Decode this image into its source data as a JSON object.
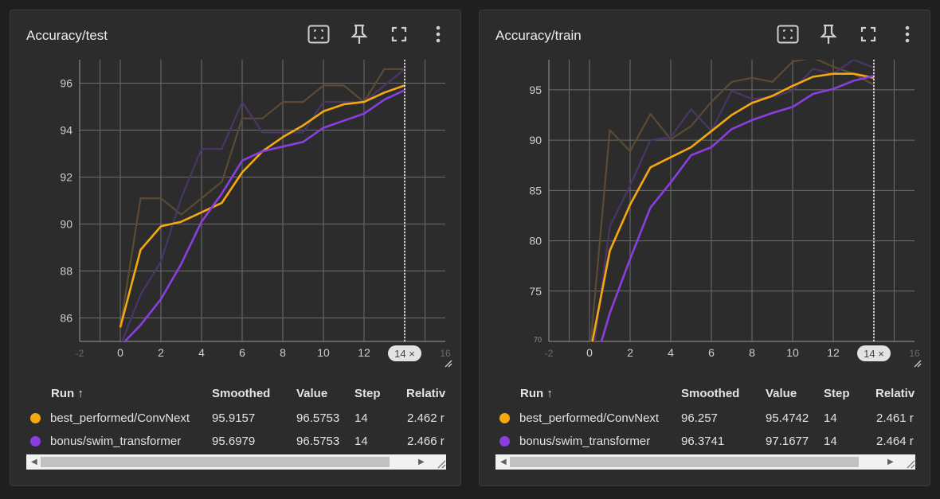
{
  "colors": {
    "convnext": "#f5a90e",
    "swim": "#8a3ee0",
    "convnext_raw": "#5b4b33",
    "swim_raw": "#4a3566",
    "grid": "#6e6e6e",
    "cursor": "#ffffff"
  },
  "icons": [
    "fit-domain-icon",
    "pin-icon",
    "fullscreen-icon",
    "more-vert-icon",
    "resize-corner-icon"
  ],
  "table": {
    "headers": {
      "run": "Run ↑",
      "smoothed": "Smoothed",
      "value": "Value",
      "step": "Step",
      "relative": "Relativ"
    }
  },
  "panels": [
    {
      "title": "Accuracy/test",
      "chart_data": {
        "type": "line",
        "x": [
          0,
          1,
          2,
          3,
          4,
          5,
          6,
          7,
          8,
          9,
          10,
          11,
          12,
          13,
          14
        ],
        "xlim": [
          -2,
          16
        ],
        "ylim": [
          85,
          97
        ],
        "y_ticks": [
          86,
          88,
          90,
          92,
          94,
          96
        ],
        "x_ticks": [
          0,
          2,
          4,
          6,
          8,
          10,
          12
        ],
        "x_tick_labels": [
          "-2",
          "0",
          "2",
          "4",
          "6",
          "8",
          "10",
          "12",
          "16"
        ],
        "cursor_step": 14,
        "cursor_label": "14 ×",
        "series": [
          {
            "name": "best_performed/ConvNext",
            "key": "convnext",
            "values": [
              85.6,
              88.9,
              89.9,
              90.1,
              90.5,
              90.9,
              92.2,
              93.1,
              93.7,
              94.2,
              94.8,
              95.1,
              95.2,
              95.6,
              95.9
            ]
          },
          {
            "name": "best_performed/ConvNext",
            "key": "convnext_raw",
            "values": [
              85.6,
              91.1,
              91.1,
              90.4,
              91.1,
              91.8,
              94.5,
              94.5,
              95.2,
              95.2,
              95.9,
              95.9,
              95.2,
              96.6,
              96.6
            ]
          },
          {
            "name": "bonus/swim_transformer",
            "key": "swim",
            "values": [
              84.8,
              85.7,
              86.8,
              88.3,
              90.1,
              91.3,
              92.7,
              93.1,
              93.3,
              93.5,
              94.1,
              94.4,
              94.7,
              95.3,
              95.7
            ]
          },
          {
            "name": "bonus/swim_transformer",
            "key": "swim_raw",
            "values": [
              84.8,
              87.0,
              88.4,
              91.1,
              93.2,
              93.2,
              95.2,
              93.9,
              93.9,
              93.9,
              95.2,
              95.2,
              95.2,
              95.9,
              96.6
            ]
          }
        ]
      },
      "rows": [
        {
          "run": "best_performed/ConvNext",
          "color": "#f5a90e",
          "smoothed": "95.9157",
          "value": "96.5753",
          "step": "14",
          "relative": "2.462 r"
        },
        {
          "run": "bonus/swim_transformer",
          "color": "#8a3ee0",
          "smoothed": "95.6979",
          "value": "96.5753",
          "step": "14",
          "relative": "2.466 r"
        }
      ]
    },
    {
      "title": "Accuracy/train",
      "chart_data": {
        "type": "line",
        "x": [
          0,
          1,
          2,
          3,
          4,
          5,
          6,
          7,
          8,
          9,
          10,
          11,
          12,
          13,
          14
        ],
        "xlim": [
          -2,
          16
        ],
        "ylim": [
          70,
          98
        ],
        "y_ticks": [
          70,
          75,
          80,
          85,
          90,
          95
        ],
        "y_tick_labels": [
          "70",
          "75",
          "80",
          "85",
          "90",
          "95"
        ],
        "x_ticks": [
          0,
          2,
          4,
          6,
          8,
          10,
          12
        ],
        "x_tick_labels": [
          "-2",
          "0",
          "2",
          "4",
          "6",
          "8",
          "10",
          "12",
          "16"
        ],
        "cursor_step": 14,
        "cursor_label": "14 ×",
        "series": [
          {
            "name": "best_performed/ConvNext",
            "key": "convnext",
            "values": [
              68.5,
              79.0,
              83.6,
              87.3,
              88.3,
              89.3,
              90.9,
              92.5,
              93.7,
              94.4,
              95.4,
              96.3,
              96.6,
              96.6,
              96.2
            ]
          },
          {
            "name": "best_performed/ConvNext",
            "key": "convnext_raw",
            "values": [
              68.5,
              91.0,
              88.9,
              92.6,
              90.1,
              91.4,
              93.8,
              95.8,
              96.2,
              95.8,
              97.8,
              98.2,
              97.3,
              96.6,
              95.5
            ]
          },
          {
            "name": "bonus/swim_transformer",
            "key": "swim",
            "values": [
              66.0,
              72.8,
              78.2,
              83.3,
              85.8,
              88.5,
              89.3,
              91.1,
              92.0,
              92.7,
              93.3,
              94.6,
              95.1,
              95.9,
              96.4
            ]
          },
          {
            "name": "bonus/swim_transformer",
            "key": "swim_raw",
            "values": [
              66.0,
              81.4,
              85.5,
              90.0,
              90.3,
              93.1,
              90.9,
              94.9,
              94.1,
              94.3,
              94.9,
              97.1,
              96.6,
              98.0,
              97.2
            ]
          }
        ]
      },
      "rows": [
        {
          "run": "best_performed/ConvNext",
          "color": "#f5a90e",
          "smoothed": "96.257",
          "value": "95.4742",
          "step": "14",
          "relative": "2.461 r"
        },
        {
          "run": "bonus/swim_transformer",
          "color": "#8a3ee0",
          "smoothed": "96.3741",
          "value": "97.1677",
          "step": "14",
          "relative": "2.464 r"
        }
      ]
    }
  ]
}
